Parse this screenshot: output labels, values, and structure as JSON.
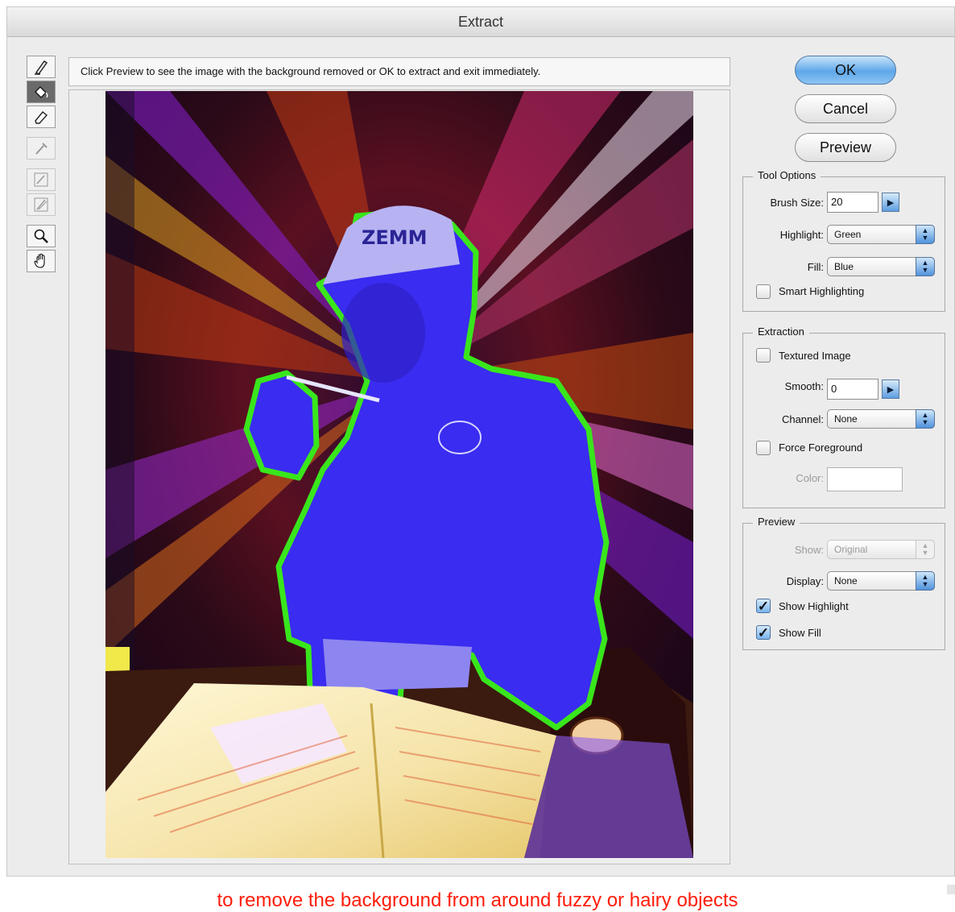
{
  "window": {
    "title": "Extract"
  },
  "hint_text": "Click Preview to see the image with the background removed or OK to extract and exit immediately.",
  "tools": [
    {
      "name": "edge-highlighter-tool",
      "icon": "edge-highlighter-icon",
      "state": "normal"
    },
    {
      "name": "fill-tool",
      "icon": "paint-bucket-icon",
      "state": "active"
    },
    {
      "name": "eraser-tool",
      "icon": "eraser-icon",
      "state": "normal"
    },
    {
      "name": "eyedropper-tool",
      "icon": "eyedropper-icon",
      "state": "disabled"
    },
    {
      "name": "cleanup-tool",
      "icon": "cleanup-icon",
      "state": "disabled"
    },
    {
      "name": "edge-touchup-tool",
      "icon": "edge-touchup-icon",
      "state": "disabled"
    },
    {
      "name": "zoom-tool",
      "icon": "magnifier-icon",
      "state": "normal"
    },
    {
      "name": "hand-tool",
      "icon": "hand-icon",
      "state": "normal"
    }
  ],
  "buttons": {
    "ok": "OK",
    "cancel": "Cancel",
    "preview": "Preview"
  },
  "tool_options": {
    "legend": "Tool Options",
    "brush_size_label": "Brush Size:",
    "brush_size_value": "20",
    "highlight_label": "Highlight:",
    "highlight_value": "Green",
    "fill_label": "Fill:",
    "fill_value": "Blue",
    "smart_highlighting_label": "Smart Highlighting",
    "smart_highlighting_checked": false
  },
  "extraction": {
    "legend": "Extraction",
    "textured_image_label": "Textured Image",
    "textured_image_checked": false,
    "smooth_label": "Smooth:",
    "smooth_value": "0",
    "channel_label": "Channel:",
    "channel_value": "None",
    "force_foreground_label": "Force Foreground",
    "force_foreground_checked": false,
    "color_label": "Color:",
    "color_value": ""
  },
  "preview_group": {
    "legend": "Preview",
    "show_label": "Show:",
    "show_value": "Original",
    "display_label": "Display:",
    "display_value": "None",
    "show_highlight_label": "Show Highlight",
    "show_highlight_checked": true,
    "show_fill_label": "Show Fill",
    "show_fill_checked": true
  },
  "photo_cap_text": "ZEMM",
  "caption": "to remove the background from around fuzzy or hairy objects",
  "colors": {
    "highlight": "#39e61c",
    "fill": "#3a2cf0",
    "caption": "#ff1d0b",
    "ok_blue": "#5ea6e8"
  }
}
